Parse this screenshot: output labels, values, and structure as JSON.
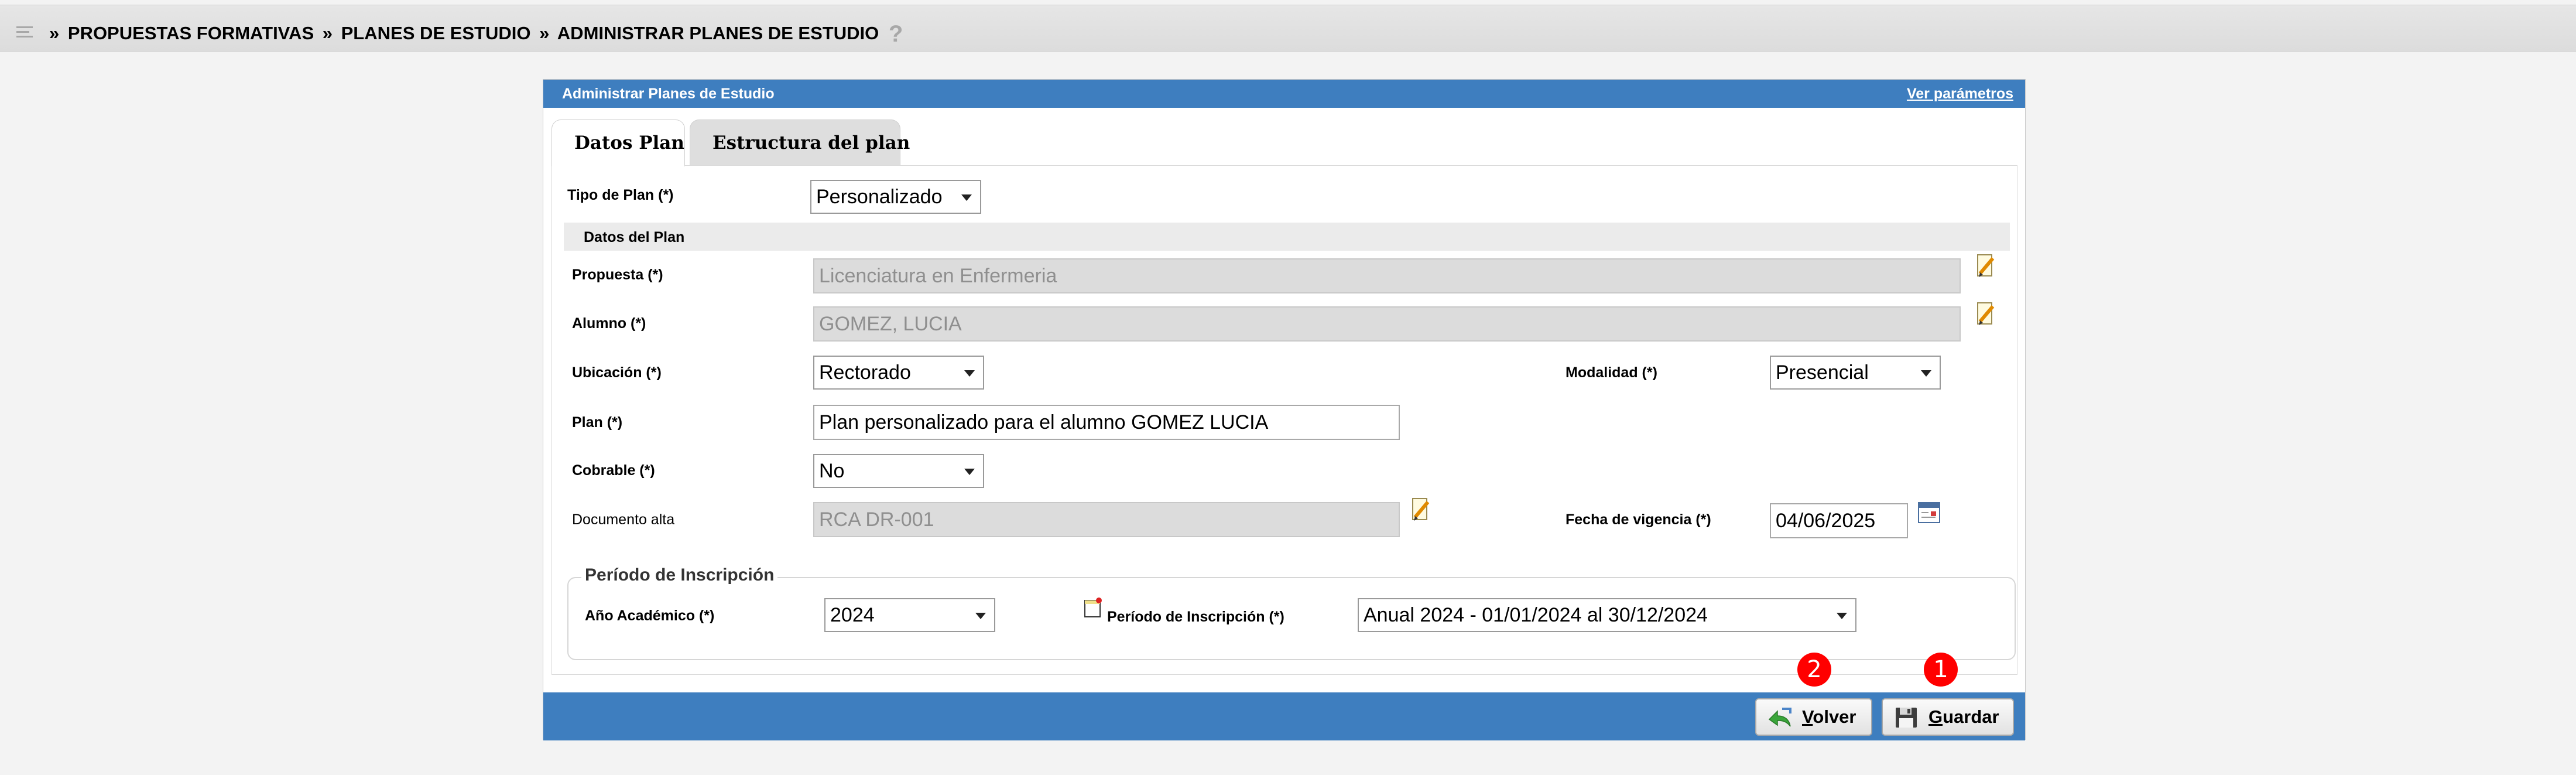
{
  "breadcrumb": {
    "items": [
      "PROPUESTAS FORMATIVAS",
      "PLANES DE ESTUDIO",
      "ADMINISTRAR PLANES DE ESTUDIO"
    ],
    "separator": "»",
    "help_glyph": "?"
  },
  "panel": {
    "title": "Administrar Planes de Estudio",
    "params_link": "Ver parámetros"
  },
  "tabs": [
    {
      "label": "Datos Plan",
      "active": true
    },
    {
      "label": "Estructura del plan",
      "active": false
    }
  ],
  "form": {
    "tipo_plan": {
      "label": "Tipo de Plan (*)",
      "value": "Personalizado"
    },
    "section_title": "Datos del Plan",
    "propuesta": {
      "label": "Propuesta (*)",
      "value": "Licenciatura en Enfermeria"
    },
    "alumno": {
      "label": "Alumno (*)",
      "value": "GOMEZ, LUCIA"
    },
    "ubicacion": {
      "label": "Ubicación (*)",
      "value": "Rectorado"
    },
    "modalidad": {
      "label": "Modalidad (*)",
      "value": "Presencial"
    },
    "plan": {
      "label": "Plan (*)",
      "value": "Plan personalizado para el alumno GOMEZ LUCIA"
    },
    "cobrable": {
      "label": "Cobrable (*)",
      "value": "No"
    },
    "documento_alta": {
      "label": "Documento alta",
      "value": "RCA DR-001"
    },
    "fecha_vigencia": {
      "label": "Fecha de vigencia (*)",
      "value": "04/06/2025"
    }
  },
  "inscripcion": {
    "legend": "Período de Inscripción",
    "anio": {
      "label": "Año Académico (*)",
      "value": "2024"
    },
    "periodo": {
      "label": "Período de Inscripción (*)",
      "value": "Anual 2024 - 01/01/2024 al 30/12/2024"
    }
  },
  "badges": {
    "volver": "2",
    "guardar": "1"
  },
  "buttons": {
    "volver": {
      "accel": "V",
      "rest": "olver"
    },
    "guardar": {
      "accel": "G",
      "rest": "uardar"
    }
  },
  "colors": {
    "header_blue": "#3e7ebf",
    "badge_red": "#ff0000",
    "disabled_field": "#dcdcdc"
  },
  "icons": [
    "menu-icon",
    "help-icon",
    "pencil-icon",
    "calendar-icon",
    "note-icon",
    "back-arrow-icon",
    "floppy-disk-icon"
  ]
}
